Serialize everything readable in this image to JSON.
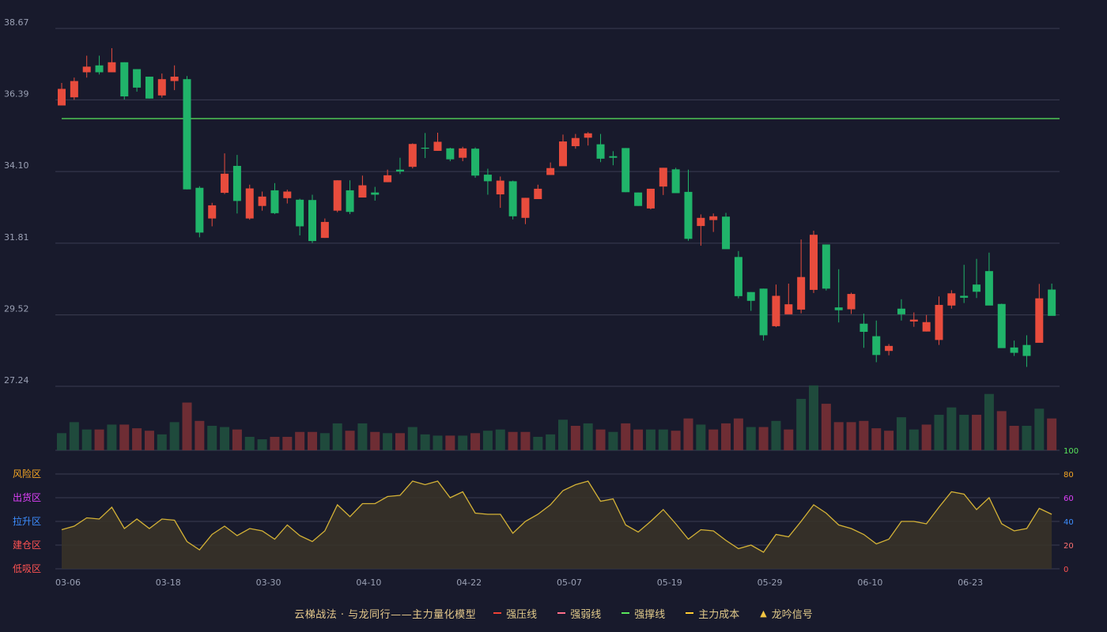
{
  "chart_data": {
    "type": "candlestick",
    "x_ticks": [
      "03-06",
      "03-18",
      "03-30",
      "04-10",
      "04-22",
      "05-07",
      "05-19",
      "05-29",
      "06-10",
      "06-23"
    ],
    "x_tick_index": [
      0,
      8,
      16,
      24,
      32,
      40,
      48,
      56,
      64,
      72
    ],
    "price_axis": {
      "ticks": [
        "38.67",
        "36.39",
        "34.10",
        "31.81",
        "29.52",
        "27.24"
      ],
      "min": 27.24,
      "max": 38.67
    },
    "resistance_line": 35.79,
    "candles": [
      [
        36.21,
        36.74,
        36.35,
        36.93
      ],
      [
        36.47,
        36.99,
        36.39,
        37.1
      ],
      [
        37.27,
        37.45,
        37.1,
        37.8
      ],
      [
        37.49,
        37.27,
        37.2,
        37.8
      ],
      [
        37.27,
        37.59,
        37.27,
        38.04
      ],
      [
        37.59,
        36.5,
        36.4,
        37.59
      ],
      [
        37.37,
        36.78,
        36.65,
        37.37
      ],
      [
        37.13,
        36.43,
        36.43,
        37.13
      ],
      [
        36.53,
        37.05,
        36.46,
        37.23
      ],
      [
        36.99,
        37.13,
        36.7,
        37.49
      ],
      [
        37.05,
        33.53,
        33.53,
        37.15
      ],
      [
        33.58,
        32.15,
        32.0,
        33.63
      ],
      [
        32.6,
        33.02,
        32.35,
        33.1
      ],
      [
        33.42,
        34.03,
        33.38,
        34.68
      ],
      [
        34.28,
        33.16,
        32.76,
        34.63
      ],
      [
        32.6,
        33.56,
        32.56,
        33.68
      ],
      [
        33.0,
        33.3,
        32.85,
        33.46
      ],
      [
        33.5,
        32.77,
        32.74,
        33.73
      ],
      [
        33.25,
        33.46,
        33.08,
        33.52
      ],
      [
        33.2,
        32.35,
        32.06,
        33.23
      ],
      [
        33.19,
        31.88,
        31.82,
        33.36
      ],
      [
        31.98,
        32.49,
        31.98,
        32.6
      ],
      [
        32.85,
        33.82,
        32.8,
        33.82
      ],
      [
        33.5,
        32.81,
        32.74,
        33.82
      ],
      [
        33.27,
        33.66,
        33.27,
        33.97
      ],
      [
        33.43,
        33.36,
        33.17,
        33.61
      ],
      [
        33.76,
        33.98,
        33.76,
        34.16
      ],
      [
        34.16,
        34.1,
        34.02,
        34.54
      ],
      [
        34.25,
        34.98,
        34.2,
        35.0
      ],
      [
        34.86,
        34.83,
        34.53,
        35.33
      ],
      [
        34.76,
        35.05,
        34.76,
        35.34
      ],
      [
        34.84,
        34.49,
        34.43,
        34.86
      ],
      [
        34.54,
        34.84,
        34.43,
        34.89
      ],
      [
        34.83,
        33.97,
        33.9,
        34.87
      ],
      [
        34.0,
        33.79,
        33.36,
        34.19
      ],
      [
        33.37,
        33.81,
        32.94,
        33.94
      ],
      [
        33.79,
        32.67,
        32.57,
        33.81
      ],
      [
        32.62,
        33.26,
        32.42,
        33.26
      ],
      [
        33.22,
        33.55,
        33.22,
        33.68
      ],
      [
        33.99,
        34.21,
        33.99,
        34.39
      ],
      [
        34.27,
        35.06,
        34.28,
        35.28
      ],
      [
        34.91,
        35.17,
        34.83,
        35.3
      ],
      [
        35.18,
        35.32,
        34.93,
        35.36
      ],
      [
        34.97,
        34.51,
        34.4,
        35.3
      ],
      [
        34.59,
        34.54,
        34.3,
        34.75
      ],
      [
        34.85,
        33.44,
        33.44,
        34.85
      ],
      [
        33.43,
        33.0,
        33.0,
        33.43
      ],
      [
        32.92,
        33.55,
        32.89,
        33.55
      ],
      [
        33.62,
        34.22,
        33.35,
        34.22
      ],
      [
        34.17,
        33.41,
        33.44,
        34.22
      ],
      [
        33.45,
        31.95,
        31.89,
        34.16
      ],
      [
        32.36,
        32.62,
        31.73,
        32.73
      ],
      [
        32.55,
        32.67,
        32.17,
        32.76
      ],
      [
        32.66,
        31.62,
        31.82,
        32.78
      ],
      [
        31.37,
        30.12,
        30.05,
        31.56
      ],
      [
        30.25,
        29.97,
        29.65,
        30.25
      ],
      [
        30.36,
        28.87,
        28.7,
        30.36
      ],
      [
        29.16,
        30.13,
        29.13,
        30.49
      ],
      [
        29.54,
        29.86,
        29.62,
        30.52
      ],
      [
        29.69,
        30.73,
        29.57,
        31.93
      ],
      [
        30.32,
        32.08,
        30.22,
        32.21
      ],
      [
        31.77,
        30.36,
        30.3,
        31.77
      ],
      [
        29.76,
        29.67,
        29.28,
        30.98
      ],
      [
        29.7,
        30.19,
        29.55,
        30.23
      ],
      [
        29.24,
        28.98,
        28.47,
        29.56
      ],
      [
        28.84,
        28.24,
        28.01,
        29.34
      ],
      [
        28.37,
        28.53,
        28.23,
        28.59
      ],
      [
        29.72,
        29.54,
        29.34,
        30.02
      ],
      [
        29.31,
        29.37,
        29.14,
        29.6
      ],
      [
        28.99,
        29.29,
        28.99,
        29.52
      ],
      [
        28.72,
        29.84,
        28.56,
        30.11
      ],
      [
        29.82,
        30.21,
        29.72,
        30.31
      ],
      [
        30.13,
        30.07,
        29.9,
        31.12
      ],
      [
        30.49,
        30.26,
        30.06,
        31.31
      ],
      [
        30.92,
        29.82,
        29.85,
        31.51
      ],
      [
        29.87,
        28.46,
        28.47,
        29.88
      ],
      [
        28.48,
        28.31,
        28.21,
        28.7
      ],
      [
        28.56,
        28.21,
        27.86,
        28.87
      ],
      [
        28.63,
        30.05,
        28.66,
        30.51
      ],
      [
        30.33,
        29.49,
        29.5,
        30.52
      ]
    ],
    "volume": [
      [
        14,
        "d"
      ],
      [
        23,
        "d"
      ],
      [
        17,
        "d"
      ],
      [
        17,
        "r"
      ],
      [
        21,
        "d"
      ],
      [
        21,
        "r"
      ],
      [
        18,
        "r"
      ],
      [
        16,
        "r"
      ],
      [
        13,
        "d"
      ],
      [
        23,
        "d"
      ],
      [
        39,
        "r"
      ],
      [
        24,
        "r"
      ],
      [
        20,
        "d"
      ],
      [
        19,
        "d"
      ],
      [
        17,
        "r"
      ],
      [
        11,
        "d"
      ],
      [
        9,
        "d"
      ],
      [
        11,
        "r"
      ],
      [
        11,
        "r"
      ],
      [
        15,
        "r"
      ],
      [
        15,
        "r"
      ],
      [
        14,
        "d"
      ],
      [
        22,
        "d"
      ],
      [
        16,
        "r"
      ],
      [
        22,
        "d"
      ],
      [
        15,
        "r"
      ],
      [
        14,
        "d"
      ],
      [
        14,
        "r"
      ],
      [
        19,
        "d"
      ],
      [
        13,
        "d"
      ],
      [
        12,
        "d"
      ],
      [
        12,
        "r"
      ],
      [
        12,
        "d"
      ],
      [
        14,
        "r"
      ],
      [
        16,
        "d"
      ],
      [
        17,
        "d"
      ],
      [
        15,
        "r"
      ],
      [
        15,
        "r"
      ],
      [
        11,
        "d"
      ],
      [
        13,
        "d"
      ],
      [
        25,
        "d"
      ],
      [
        20,
        "r"
      ],
      [
        22,
        "d"
      ],
      [
        17,
        "r"
      ],
      [
        15,
        "d"
      ],
      [
        22,
        "r"
      ],
      [
        17,
        "r"
      ],
      [
        17,
        "d"
      ],
      [
        17,
        "d"
      ],
      [
        16,
        "r"
      ],
      [
        26,
        "r"
      ],
      [
        21,
        "d"
      ],
      [
        17,
        "r"
      ],
      [
        22,
        "r"
      ],
      [
        26,
        "r"
      ],
      [
        19,
        "d"
      ],
      [
        19,
        "r"
      ],
      [
        24,
        "d"
      ],
      [
        17,
        "r"
      ],
      [
        42,
        "d"
      ],
      [
        53,
        "d"
      ],
      [
        38,
        "r"
      ],
      [
        23,
        "r"
      ],
      [
        23,
        "r"
      ],
      [
        24,
        "r"
      ],
      [
        18,
        "r"
      ],
      [
        16,
        "r"
      ],
      [
        27,
        "d"
      ],
      [
        17,
        "d"
      ],
      [
        21,
        "r"
      ],
      [
        29,
        "d"
      ],
      [
        35,
        "d"
      ],
      [
        29,
        "d"
      ],
      [
        29,
        "r"
      ],
      [
        46,
        "d"
      ],
      [
        32,
        "r"
      ],
      [
        20,
        "r"
      ],
      [
        20,
        "d"
      ],
      [
        34,
        "d"
      ],
      [
        26,
        "r"
      ]
    ],
    "indicator": {
      "axis_ticks": [
        0,
        20,
        40,
        60,
        80,
        100
      ],
      "zones": [
        "风险区",
        "出货区",
        "拉升区",
        "建仓区",
        "低吸区"
      ],
      "values": [
        33,
        36,
        43,
        42,
        52,
        34,
        42,
        34,
        42,
        41,
        23,
        16,
        29,
        36,
        28,
        34,
        32,
        25,
        37,
        28,
        23,
        32,
        54,
        44,
        55,
        55,
        61,
        62,
        74,
        71,
        74,
        60,
        65,
        47,
        46,
        46,
        30,
        40,
        46,
        54,
        66,
        71,
        74,
        57,
        59,
        37,
        31,
        40,
        50,
        38,
        25,
        33,
        32,
        24,
        17,
        20,
        14,
        29,
        27,
        40,
        54,
        47,
        37,
        34,
        29,
        21,
        25,
        40,
        40,
        38,
        52,
        65,
        63,
        50,
        60,
        38,
        32,
        34,
        51,
        46
      ]
    }
  },
  "legend": {
    "title": "云梯战法 · 与龙同行——主力量化模型",
    "items": [
      {
        "label": "强压线",
        "color": "#ef4136",
        "style": "solid"
      },
      {
        "label": "强弱线",
        "color": "#ff6e8a",
        "style": "dashed"
      },
      {
        "label": "强撑线",
        "color": "#59e65c",
        "style": "solid"
      },
      {
        "label": "主力成本",
        "color": "#ffcc33",
        "style": "dashed"
      },
      {
        "label": "龙吟信号",
        "color": "#f2c542",
        "style": "triangle"
      }
    ]
  },
  "colors": {
    "up": "#e84c3d",
    "down": "#20b46a",
    "vol_up": "#6e2d34",
    "vol_down": "#1f4a3c",
    "grid": "#3a3c52",
    "axis_text": "#9aa0b4",
    "indicator_line": "#d4b236",
    "indicator_fill": "#3a3428",
    "resistance": "#59e65c",
    "zone_colors": [
      "#f5a623",
      "#e040fb",
      "#3d8eff",
      "#ff5252",
      "#ff5252"
    ],
    "right_axis_colors": [
      "#59e65c",
      "#f5a623",
      "#e040fb",
      "#3d8eff",
      "#ff7070",
      "#ff5252"
    ]
  }
}
